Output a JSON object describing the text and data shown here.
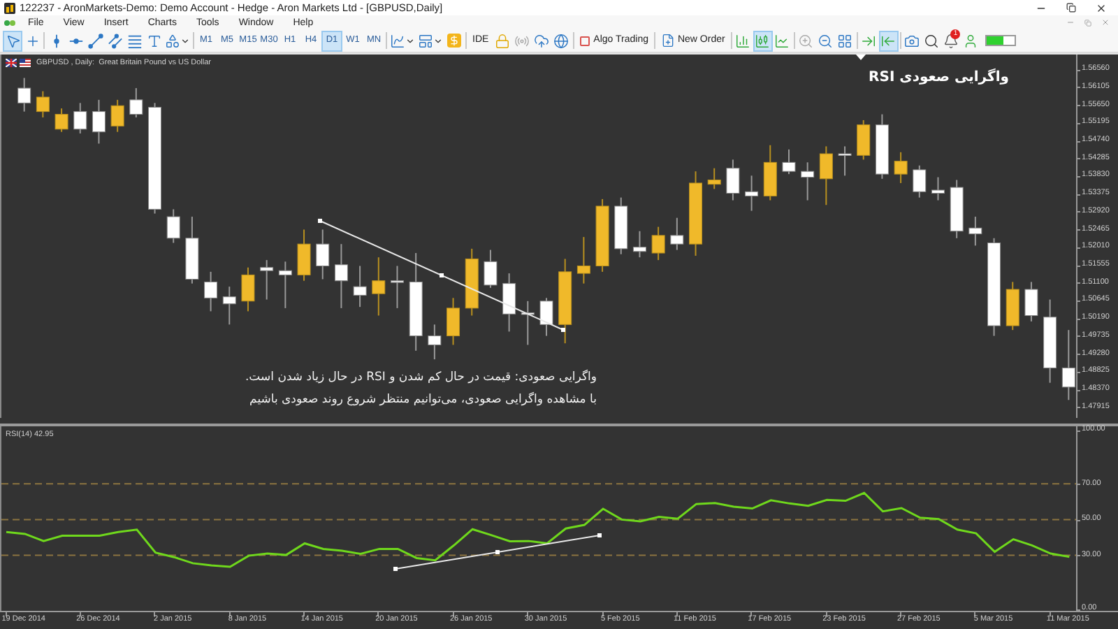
{
  "window": {
    "title": "122237 - AronMarkets-Demo: Demo Account - Hedge - Aron Markets Ltd - [GBPUSD,Daily]"
  },
  "menu": [
    "File",
    "View",
    "Insert",
    "Charts",
    "Tools",
    "Window",
    "Help"
  ],
  "toolbar": {
    "left_groups": [
      [
        {
          "kind": "cursor",
          "selected": true
        },
        {
          "kind": "crosshair",
          "selected": false
        }
      ],
      [
        {
          "kind": "vline",
          "selected": false
        },
        {
          "kind": "hline",
          "selected": false
        },
        {
          "kind": "trendline",
          "selected": false
        },
        {
          "kind": "channel",
          "selected": false
        },
        {
          "kind": "fibo",
          "selected": false
        },
        {
          "kind": "text",
          "selected": false
        },
        {
          "kind": "shapes",
          "selected": false
        }
      ]
    ],
    "timeframes": [
      {
        "label": "M1",
        "selected": false
      },
      {
        "label": "M5",
        "selected": false
      },
      {
        "label": "M15",
        "selected": false
      },
      {
        "label": "M30",
        "selected": false
      },
      {
        "label": "H1",
        "selected": false
      },
      {
        "label": "H4",
        "selected": false
      },
      {
        "label": "D1",
        "selected": true
      },
      {
        "label": "W1",
        "selected": false
      },
      {
        "label": "MN",
        "selected": false
      }
    ],
    "right_groups": [
      [
        {
          "kind": "indicators",
          "selected": false
        },
        {
          "kind": "templates",
          "selected": false
        },
        {
          "kind": "market",
          "selected": false
        }
      ],
      [
        {
          "kind": "ide",
          "label": "IDE",
          "selected": false
        },
        {
          "kind": "lock",
          "selected": false
        },
        {
          "kind": "signal",
          "selected": false
        },
        {
          "kind": "cloud",
          "selected": false
        },
        {
          "kind": "globe",
          "selected": false
        }
      ],
      [
        {
          "kind": "algo",
          "label": "Algo Trading",
          "selected": false
        }
      ],
      [
        {
          "kind": "order",
          "label": "New Order",
          "selected": false
        }
      ],
      [
        {
          "kind": "bars",
          "selected": false
        },
        {
          "kind": "candles",
          "selected": true
        },
        {
          "kind": "line",
          "selected": false
        }
      ],
      [
        {
          "kind": "zoom_in",
          "selected": false
        },
        {
          "kind": "zoom_out",
          "selected": false
        },
        {
          "kind": "tile",
          "selected": false
        }
      ],
      [
        {
          "kind": "shift",
          "selected": false
        },
        {
          "kind": "autoscroll",
          "selected": true
        }
      ],
      [
        {
          "kind": "screenshot",
          "selected": false
        },
        {
          "kind": "search",
          "selected": false
        },
        {
          "kind": "alerts",
          "badge": "1",
          "selected": false
        },
        {
          "kind": "account",
          "selected": false
        },
        {
          "kind": "connection",
          "selected": false
        }
      ]
    ]
  },
  "chart": {
    "header": "GBPUSD , Daily:  Great Britain Pound vs US Dollar",
    "title": "واگرایی صعودی RSI",
    "note": [
      "واگرایی صعودی: قیمت در حال کم شدن و RSI در حال زیاد شدن است.",
      "با مشاهده واگرایی صعودی، می‌توانیم منتظر شروع روند صعودی باشیم"
    ],
    "chart_data": {
      "type": "candlestick",
      "ylim": [
        1.4764,
        1.5694
      ],
      "categories": [
        null,
        null,
        null,
        null,
        null,
        null,
        null,
        null,
        null,
        null,
        null,
        null,
        null,
        null,
        null,
        null,
        null,
        null,
        null,
        null,
        null,
        null,
        null,
        null,
        null,
        null,
        null,
        null,
        null,
        null,
        null,
        null,
        null,
        null,
        null,
        null,
        null,
        null,
        null,
        null,
        null,
        null,
        null,
        null,
        null,
        null,
        null,
        null,
        null,
        null,
        null,
        null,
        null,
        null,
        null,
        null,
        null
      ],
      "ohlc": [
        [
          1.5608,
          1.5634,
          1.5548,
          1.557
        ],
        [
          1.5548,
          1.56,
          1.5533,
          1.5585
        ],
        [
          1.5503,
          1.5556,
          1.5496,
          1.5541
        ],
        [
          1.5548,
          1.557,
          1.5492,
          1.5503
        ],
        [
          1.5548,
          1.5578,
          1.5466,
          1.5496
        ],
        [
          1.5511,
          1.5578,
          1.5496,
          1.5563
        ],
        [
          1.5578,
          1.5608,
          1.5533,
          1.5541
        ],
        [
          1.5559,
          1.557,
          1.5287,
          1.5298
        ],
        [
          1.5279,
          1.5298,
          1.5212,
          1.5224
        ],
        [
          1.5224,
          1.5279,
          1.5108,
          1.5119
        ],
        [
          1.5112,
          1.5138,
          1.5037,
          1.5071
        ],
        [
          1.5074,
          1.51,
          1.5003,
          1.5056
        ],
        [
          1.5063,
          1.5149,
          1.5037,
          1.513
        ],
        [
          1.5149,
          1.5168,
          1.5067,
          1.5141
        ],
        [
          1.5141,
          1.5164,
          1.5045,
          1.513
        ],
        [
          1.513,
          1.5246,
          1.5115,
          1.5209
        ],
        [
          1.5209,
          1.5246,
          1.5119,
          1.5153
        ],
        [
          1.5156,
          1.5209,
          1.5045,
          1.5115
        ],
        [
          1.51,
          1.5153,
          1.5048,
          1.5078
        ],
        [
          1.5082,
          1.5175,
          1.5026,
          1.5115
        ],
        [
          1.5115,
          1.5153,
          1.5045,
          1.5112
        ],
        [
          1.5112,
          1.5186,
          1.4936,
          1.4974
        ],
        [
          1.4974,
          1.5003,
          1.4914,
          1.4951
        ],
        [
          1.4974,
          1.5071,
          1.4951,
          1.5045
        ],
        [
          1.5045,
          1.5197,
          1.5026,
          1.5171
        ],
        [
          1.5164,
          1.5194,
          1.5097,
          1.5104
        ],
        [
          1.5108,
          1.5134,
          1.4985,
          1.503
        ],
        [
          1.5033,
          1.5063,
          1.4951,
          1.503
        ],
        [
          1.5063,
          1.5071,
          1.4974,
          1.5003
        ],
        [
          1.5003,
          1.5171,
          1.4955,
          1.5138
        ],
        [
          1.5134,
          1.5227,
          1.5108,
          1.5153
        ],
        [
          1.5153,
          1.5324,
          1.5138,
          1.5306
        ],
        [
          1.5306,
          1.5328,
          1.5183,
          1.5197
        ],
        [
          1.5201,
          1.5242,
          1.5175,
          1.519
        ],
        [
          1.5186,
          1.5253,
          1.5168,
          1.5231
        ],
        [
          1.5231,
          1.5276,
          1.5194,
          1.5209
        ],
        [
          1.5209,
          1.5395,
          1.5179,
          1.5365
        ],
        [
          1.5362,
          1.5403,
          1.535,
          1.5373
        ],
        [
          1.5403,
          1.5425,
          1.5321,
          1.5339
        ],
        [
          1.5343,
          1.5384,
          1.5294,
          1.5332
        ],
        [
          1.5332,
          1.5462,
          1.5321,
          1.5418
        ],
        [
          1.5418,
          1.5451,
          1.5388,
          1.5395
        ],
        [
          1.5395,
          1.5418,
          1.5321,
          1.538
        ],
        [
          1.5376,
          1.5459,
          1.5309,
          1.544
        ],
        [
          1.544,
          1.5459,
          1.5384,
          1.5436
        ],
        [
          1.5436,
          1.5526,
          1.5425,
          1.5514
        ],
        [
          1.5514,
          1.5541,
          1.5376,
          1.5388
        ],
        [
          1.5388,
          1.5444,
          1.5365,
          1.5421
        ],
        [
          1.5399,
          1.541,
          1.5328,
          1.5343
        ],
        [
          1.5347,
          1.538,
          1.5321,
          1.5339
        ],
        [
          1.5354,
          1.5373,
          1.5224,
          1.5242
        ],
        [
          1.525,
          1.5279,
          1.5205,
          1.5235
        ],
        [
          1.5212,
          1.5224,
          1.4974,
          1.5
        ],
        [
          1.5,
          1.5112,
          1.4989,
          1.5093
        ],
        [
          1.5093,
          1.5112,
          1.5011,
          1.5026
        ],
        [
          1.5022,
          1.5067,
          1.4854,
          1.4892
        ],
        [
          1.4892,
          1.4989,
          1.481,
          1.4843
        ]
      ],
      "yticks": [
        {
          "value": 1.5656,
          "label": "1.56560"
        },
        {
          "value": 1.56105,
          "label": "1.56105"
        },
        {
          "value": 1.5565,
          "label": "1.55650"
        },
        {
          "value": 1.55195,
          "label": "1.55195"
        },
        {
          "value": 1.5474,
          "label": "1.54740"
        },
        {
          "value": 1.54285,
          "label": "1.54285"
        },
        {
          "value": 1.5383,
          "label": "1.53830"
        },
        {
          "value": 1.53375,
          "label": "1.53375"
        },
        {
          "value": 1.5292,
          "label": "1.52920"
        },
        {
          "value": 1.52465,
          "label": "1.52465"
        },
        {
          "value": 1.5201,
          "label": "1.52010"
        },
        {
          "value": 1.51555,
          "label": "1.51555"
        },
        {
          "value": 1.511,
          "label": "1.51100"
        },
        {
          "value": 1.50645,
          "label": "1.50645"
        },
        {
          "value": 1.5019,
          "label": "1.50190"
        },
        {
          "value": 1.49735,
          "label": "1.49735"
        },
        {
          "value": 1.4928,
          "label": "1.49280"
        },
        {
          "value": 1.48825,
          "label": "1.48825"
        },
        {
          "value": 1.4837,
          "label": "1.48370"
        },
        {
          "value": 1.47915,
          "label": "1.47915"
        }
      ],
      "title": null
    }
  },
  "rsi_panel": {
    "header_value": "42.95",
    "chart_data": {
      "type": "line",
      "ylim": [
        -1,
        102.1
      ],
      "categories": [
        null,
        "19 Dec 2014",
        null,
        null,
        null,
        "26 Dec 2014",
        null,
        null,
        null,
        "2 Jan 2015",
        null,
        null,
        null,
        "8 Jan 2015",
        null,
        null,
        null,
        "14 Jan 2015",
        null,
        null,
        null,
        "20 Jan 2015",
        null,
        null,
        null,
        "26 Jan 2015",
        null,
        null,
        null,
        "30 Jan 2015",
        null,
        null,
        null,
        "5 Feb 2015",
        null,
        null,
        null,
        "11 Feb 2015",
        null,
        null,
        null,
        "17 Feb 2015",
        null,
        null,
        null,
        "23 Feb 2015",
        null,
        null,
        null,
        "27 Feb 2015",
        null,
        null,
        null,
        "5 Mar 2015",
        null,
        null,
        null,
        "11 Mar 2015"
      ],
      "series": [
        {
          "name": "RSI(14)",
          "color": "#6fd81c",
          "values": [
            43,
            42,
            38,
            41,
            41,
            41,
            43,
            44.4,
            31.5,
            29,
            25.6,
            24.4,
            23.6,
            29.8,
            31,
            30.2,
            36.7,
            33.6,
            32.6,
            30.8,
            33.6,
            33.6,
            28.5,
            27.2,
            35.6,
            44.6,
            41.3,
            37.9,
            38,
            36.7,
            45,
            47,
            56,
            50,
            49,
            51.5,
            50.5,
            58.7,
            59.2,
            57.2,
            56.2,
            60.8,
            59,
            57.7,
            61,
            60.5,
            64.9,
            54.6,
            56.4,
            51,
            50.3,
            44.4,
            42.3,
            32,
            39,
            35.6,
            31,
            29.2
          ]
        }
      ],
      "yticks": [
        {
          "value": 100,
          "label": "100.00"
        },
        {
          "value": 70,
          "label": "70.00"
        },
        {
          "value": 50,
          "label": "50.00"
        },
        {
          "value": 30,
          "label": "30.00"
        },
        {
          "value": 0,
          "label": "0.00"
        }
      ],
      "grid": true
    }
  }
}
